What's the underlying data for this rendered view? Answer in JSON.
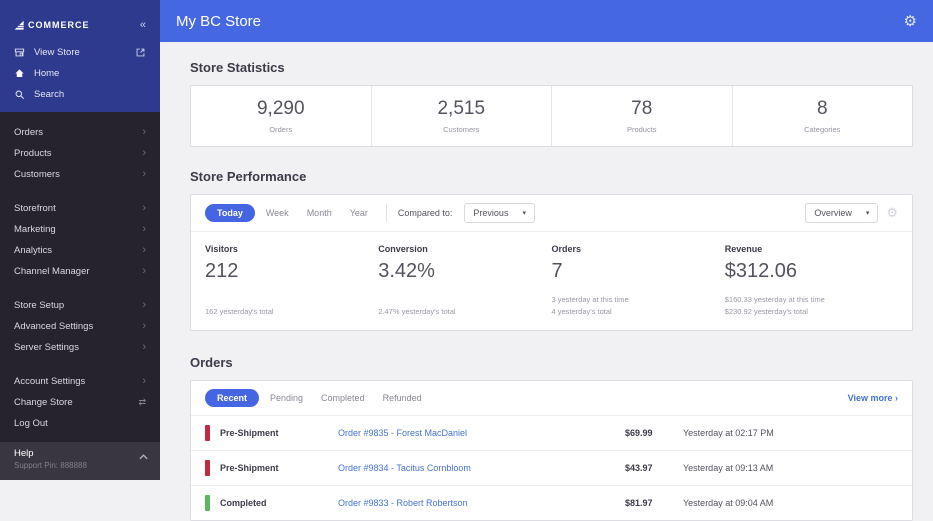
{
  "colors": {
    "header_blue": "#4667e2",
    "sidebar_navy": "#2d3a8d",
    "sidebar_dark": "#26222e",
    "accent_pill_blue": "#4565e2",
    "link_blue": "#4573d2",
    "status_red": "#c12a40",
    "status_green": "#5cb65f"
  },
  "sidebar": {
    "logo_text": "COMMERCE",
    "collapse_icon": "«",
    "top_items": [
      {
        "label": "View Store",
        "icon": "storefront-icon"
      },
      {
        "label": "Home",
        "icon": "home-icon"
      },
      {
        "label": "Search",
        "icon": "search-icon"
      }
    ],
    "groups": {
      "g0": [
        "Orders",
        "Products",
        "Customers"
      ],
      "g1": [
        "Storefront",
        "Marketing",
        "Analytics",
        "Channel Manager"
      ],
      "g2": [
        "Store Setup",
        "Advanced Settings",
        "Server Settings"
      ],
      "g3": [
        "Account Settings",
        "Change Store",
        "Log Out"
      ]
    },
    "help": {
      "title": "Help",
      "subtitle": "Support Pin: 888888"
    }
  },
  "header": {
    "title": "My BC Store",
    "settings_icon": "gear-icon"
  },
  "stats": {
    "section_title": "Store Statistics",
    "items": [
      {
        "value": "9,290",
        "label": "Orders"
      },
      {
        "value": "2,515",
        "label": "Customers"
      },
      {
        "value": "78",
        "label": "Products"
      },
      {
        "value": "8",
        "label": "Categories"
      }
    ]
  },
  "performance": {
    "section_title": "Store Performance",
    "tabs": [
      "Today",
      "Week",
      "Month",
      "Year"
    ],
    "active_tab": "Today",
    "compared_to_label": "Compared to:",
    "compared_to_value": "Previous",
    "view_select_value": "Overview",
    "metrics": [
      {
        "label": "Visitors",
        "value": "212",
        "sub1": "",
        "sub2": "162 yesterday's total"
      },
      {
        "label": "Conversion",
        "value": "3.42%",
        "sub1": "",
        "sub2": "2.47% yesterday's total"
      },
      {
        "label": "Orders",
        "value": "7",
        "sub1": "3 yesterday at this time",
        "sub2": "4 yesterday's total"
      },
      {
        "label": "Revenue",
        "value": "$312.06",
        "sub1": "$160.33 yesterday at this time",
        "sub2": "$230.92 yesterday's total"
      }
    ]
  },
  "orders": {
    "section_title": "Orders",
    "tabs": [
      "Recent",
      "Pending",
      "Completed",
      "Refunded"
    ],
    "active_tab": "Recent",
    "view_more_label": "View more  ›",
    "rows": [
      {
        "status": "Pre-Shipment",
        "status_color": "#c12a40",
        "title": "Order #9835 - Forest MacDaniel",
        "amount": "$69.99",
        "time": "Yesterday at 02:17 PM"
      },
      {
        "status": "Pre-Shipment",
        "status_color": "#c12a40",
        "title": "Order #9834 - Tacitus Cornbloom",
        "amount": "$43.97",
        "time": "Yesterday at 09:13 AM"
      },
      {
        "status": "Completed",
        "status_color": "#5cb65f",
        "title": "Order #9833 - Robert Robertson",
        "amount": "$81.97",
        "time": "Yesterday at 09:04 AM"
      }
    ]
  }
}
